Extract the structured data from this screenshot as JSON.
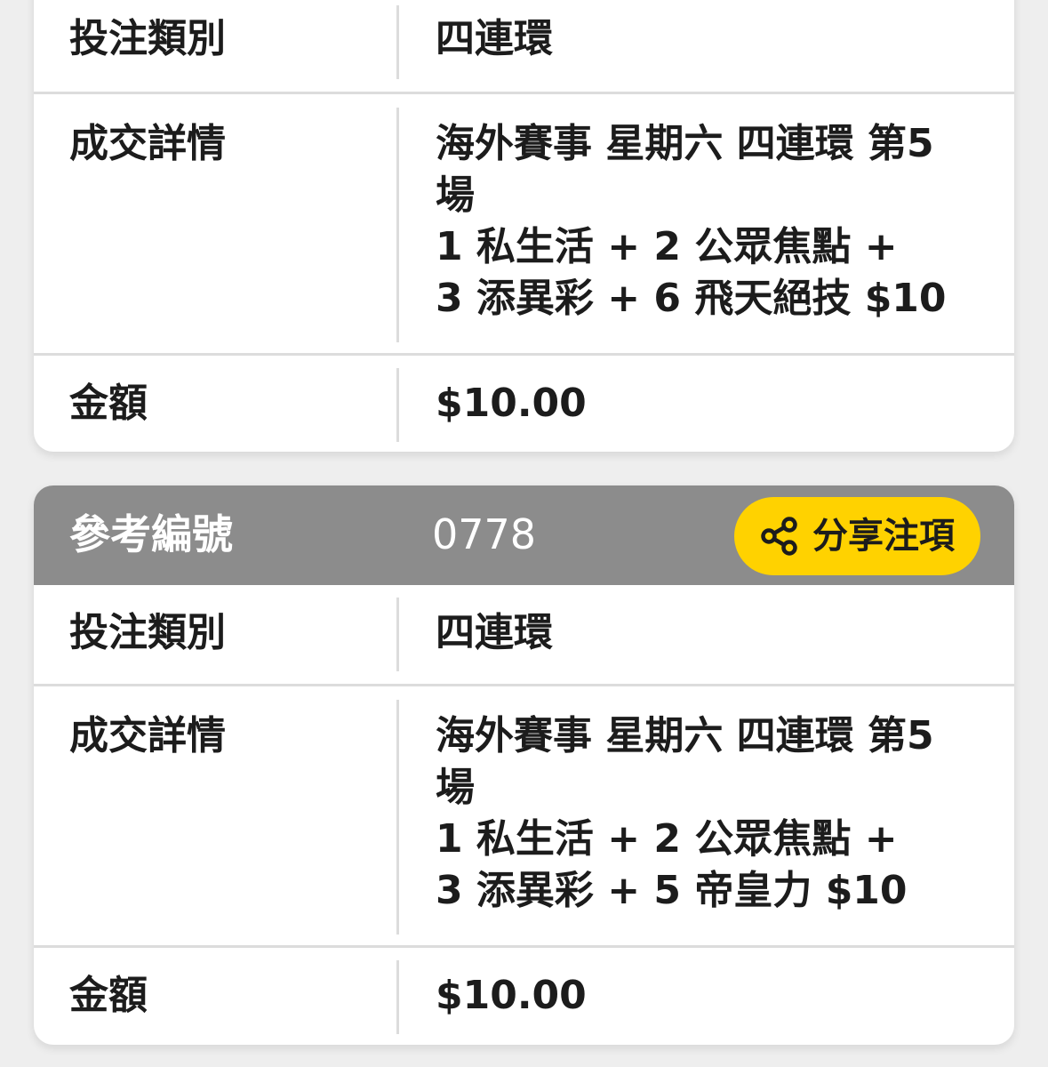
{
  "card1": {
    "bet_type_label": "投注類別",
    "bet_type_value": "四連環",
    "details_label": "成交詳情",
    "details_value": "海外賽事 星期六 四連環 第5\n場\n1 私生活 + 2 公眾焦點 +\n3 添異彩 + 6 飛天絕技 $10",
    "amount_label": "金額",
    "amount_value": "$10.00"
  },
  "card2": {
    "ref_label": "參考編號",
    "ref_value": "0778",
    "share_label": "分享注項",
    "bet_type_label": "投注類別",
    "bet_type_value": "四連環",
    "details_label": "成交詳情",
    "details_value": "海外賽事 星期六 四連環 第5\n場\n1 私生活 + 2 公眾焦點 +\n3 添異彩 + 5 帝皇力 $10",
    "amount_label": "金額",
    "amount_value": "$10.00"
  },
  "colors": {
    "header_bg": "#8c8c8c",
    "share_button_bg": "#ffd200",
    "page_bg": "#eeeeee",
    "divider": "#dcdcdc"
  },
  "icons": {
    "share": "share-icon"
  }
}
